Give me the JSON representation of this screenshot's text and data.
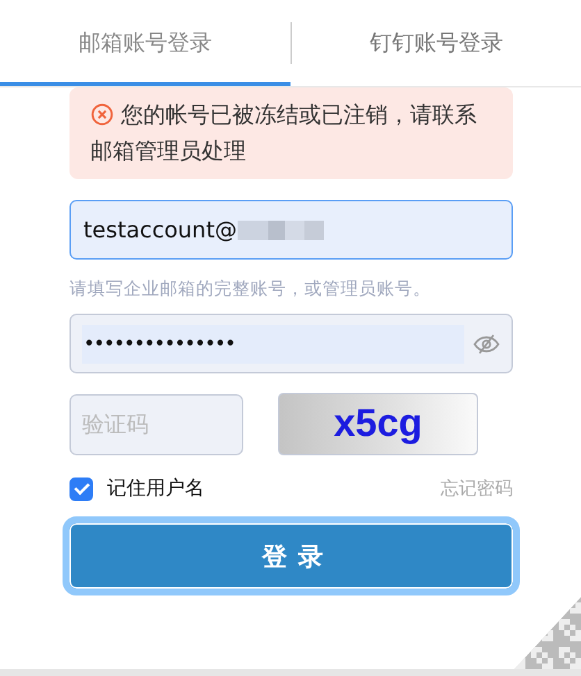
{
  "tabs": [
    {
      "label": "邮箱账号登录",
      "selected": true
    },
    {
      "label": "钉钉账号登录",
      "selected": false
    }
  ],
  "error": {
    "text": "您的帐号已被冻结或已注销，请联系邮箱管理员处理"
  },
  "email": {
    "value": "testaccount@"
  },
  "email_hint": "请填写企业邮箱的完整账号，或管理员账号。",
  "password": {
    "value": "•••••••••••••••"
  },
  "captcha": {
    "placeholder": "验证码",
    "code": "x5cg"
  },
  "remember": {
    "label": "记住用户名",
    "checked": true
  },
  "forgot_link": "忘记密码",
  "login_button": "登录"
}
